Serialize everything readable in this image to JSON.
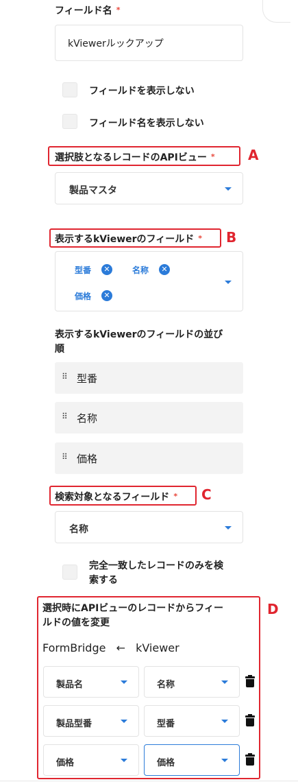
{
  "field_name": {
    "label": "フィールド名",
    "required_mark": "*",
    "value": "kViewerルックアップ"
  },
  "checkboxes": {
    "hide_field": "フィールドを表示しない",
    "hide_field_name": "フィールド名を表示しない"
  },
  "api_view": {
    "label": "選択肢となるレコードのAPIビュー",
    "required_mark": "*",
    "selected": "製品マスタ",
    "annotation": "A"
  },
  "display_fields": {
    "label": "表示するkViewerのフィールド",
    "required_mark": "*",
    "annotation": "B",
    "tags": [
      "型番",
      "名称",
      "価格"
    ]
  },
  "sort_order": {
    "label_line1": "表示するkViewerのフィールドの並び",
    "label_line2": "順",
    "items": [
      "型番",
      "名称",
      "価格"
    ]
  },
  "search_field": {
    "label": "検索対象となるフィールド",
    "required_mark": "*",
    "annotation": "C",
    "selected": "名称",
    "exact_match_line1": "完全一致したレコードのみを検",
    "exact_match_line2": "索する"
  },
  "mapping": {
    "annotation": "D",
    "label_line1": "選択時にAPIビューのレコードからフィー",
    "label_line2": "ルドの値を変更",
    "header_left": "FormBridge",
    "header_arrow": "←",
    "header_right": "kViewer",
    "rows": [
      {
        "left": "製品名",
        "right": "名称"
      },
      {
        "left": "製品型番",
        "right": "型番"
      },
      {
        "left": "価格",
        "right": "価格"
      }
    ]
  },
  "colors": {
    "accent": "#2b7bd9",
    "annotation": "#e0252f",
    "required": "#e8463a"
  }
}
